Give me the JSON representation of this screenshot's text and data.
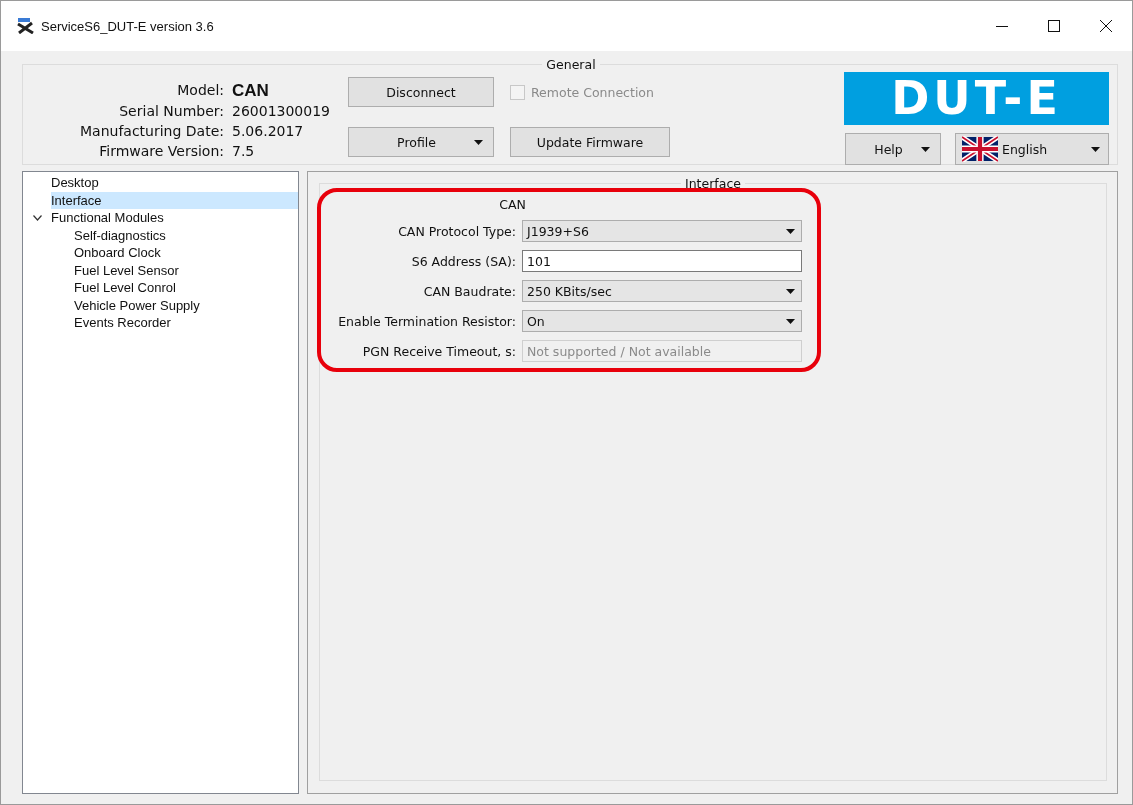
{
  "window": {
    "title": "ServiceS6_DUT-E version 3.6"
  },
  "general": {
    "title": "General",
    "info": [
      {
        "label": "Model:",
        "value": "CAN",
        "bold": true
      },
      {
        "label": "Serial Number:",
        "value": "26001300019",
        "bold": false
      },
      {
        "label": "Manufacturing Date:",
        "value": "5.06.2017",
        "bold": false
      },
      {
        "label": "Firmware Version:",
        "value": "7.5",
        "bold": false
      }
    ],
    "disconnect": "Disconnect",
    "remote": {
      "label": "Remote Connection",
      "checked": false,
      "disabled": true
    },
    "profile": "Profile",
    "update": "Update Firmware",
    "logo": "DUT-E",
    "help": "Help",
    "language": "English"
  },
  "tree": [
    {
      "label": "Desktop",
      "selected": false
    },
    {
      "label": "Interface",
      "selected": true
    },
    {
      "label": "Functional Modules",
      "selected": false,
      "expanded": true,
      "children": [
        {
          "label": "Self-diagnostics",
          "selected": false
        },
        {
          "label": "Onboard Clock",
          "selected": false
        },
        {
          "label": "Fuel Level Sensor",
          "selected": false
        },
        {
          "label": "Fuel Level Conrol",
          "selected": false
        },
        {
          "label": "Vehicle Power Supply",
          "selected": false
        },
        {
          "label": "Events Recorder",
          "selected": false
        }
      ]
    }
  ],
  "interface": {
    "title": "Interface",
    "section": "CAN",
    "highlighted": true,
    "fields": [
      {
        "label": "CAN Protocol Type:",
        "kind": "dropdown",
        "value": "J1939+S6",
        "disabled": false
      },
      {
        "label": "S6 Address (SA):",
        "kind": "input",
        "value": "101",
        "disabled": false
      },
      {
        "label": "CAN Baudrate:",
        "kind": "dropdown",
        "value": "250 KBits/sec",
        "disabled": false
      },
      {
        "label": "Enable Termination Resistor:",
        "kind": "dropdown",
        "value": "On",
        "disabled": false
      },
      {
        "label": "PGN Receive Timeout, s:",
        "kind": "input",
        "value": "Not supported / Not available",
        "disabled": true
      }
    ]
  }
}
